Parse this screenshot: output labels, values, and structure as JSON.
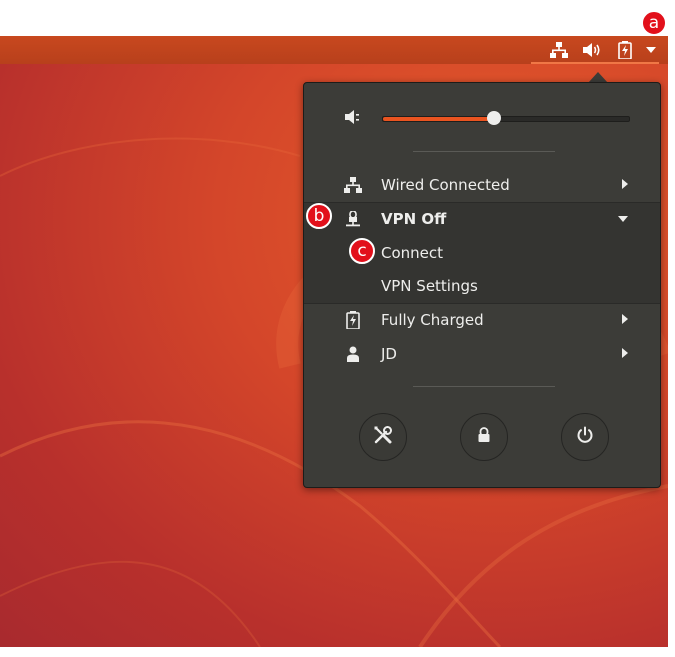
{
  "colors": {
    "accent": "#e95420",
    "menu_bg": "#3c3c38",
    "text": "#eeeeec",
    "badge": "#e2101b"
  },
  "topbar": {
    "icons": [
      "network-wired-icon",
      "speaker-volume-icon",
      "battery-charging-icon",
      "chevron-down-icon"
    ]
  },
  "menu": {
    "volume": {
      "icon": "speaker-volume-icon",
      "level": 0.45
    },
    "items": [
      {
        "icon": "network-wired-icon",
        "label": "Wired Connected",
        "expander": "right"
      },
      {
        "icon": "vpn-lock-icon",
        "label": "VPN Off",
        "expander": "down"
      },
      {
        "label": "Connect"
      },
      {
        "label": "VPN Settings"
      },
      {
        "icon": "battery-charging-icon",
        "label": "Fully Charged",
        "expander": "right"
      },
      {
        "icon": "user-icon",
        "label": "JD",
        "expander": "right"
      }
    ],
    "actions": [
      {
        "icon": "settings-tools-icon"
      },
      {
        "icon": "lock-icon"
      },
      {
        "icon": "power-icon"
      }
    ]
  },
  "annotations": [
    "a",
    "b",
    "c"
  ]
}
